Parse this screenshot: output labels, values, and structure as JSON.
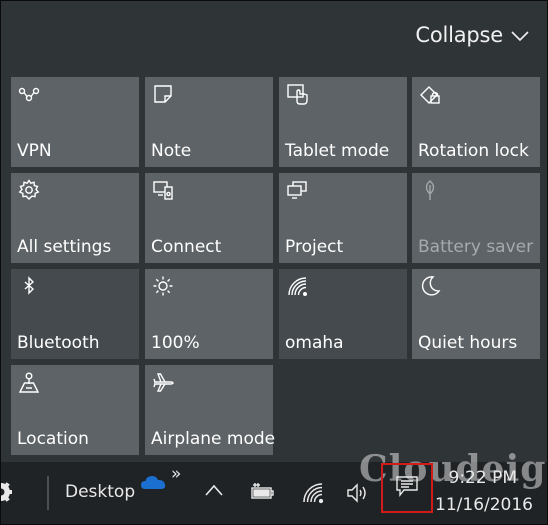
{
  "header": {
    "collapse_label": "Collapse",
    "collapse_icon": "chevron-down-icon"
  },
  "tiles": [
    {
      "label": "VPN",
      "icon": "vpn-icon",
      "state": "off"
    },
    {
      "label": "Note",
      "icon": "note-icon",
      "state": "off"
    },
    {
      "label": "Tablet mode",
      "icon": "tablet-mode-icon",
      "state": "off"
    },
    {
      "label": "Rotation lock",
      "icon": "rotation-lock-icon",
      "state": "off"
    },
    {
      "label": "All settings",
      "icon": "gear-icon",
      "state": "off"
    },
    {
      "label": "Connect",
      "icon": "connect-icon",
      "state": "off"
    },
    {
      "label": "Project",
      "icon": "project-icon",
      "state": "off"
    },
    {
      "label": "Battery saver",
      "icon": "battery-saver-icon",
      "state": "disabled"
    },
    {
      "label": "Bluetooth",
      "icon": "bluetooth-icon",
      "state": "off"
    },
    {
      "label": "100%",
      "icon": "brightness-icon",
      "state": "off"
    },
    {
      "label": "omaha",
      "icon": "wifi-icon",
      "state": "off"
    },
    {
      "label": "Quiet hours",
      "icon": "moon-icon",
      "state": "off"
    },
    {
      "label": "Location",
      "icon": "location-icon",
      "state": "off"
    },
    {
      "label": "Airplane mode",
      "icon": "airplane-icon",
      "state": "off"
    }
  ],
  "taskbar": {
    "desktop_label": "Desktop",
    "overflow_glyph": "»",
    "time": "9:22 PM",
    "date": "11/16/2016"
  },
  "watermark": "Cloudeight",
  "colors": {
    "panel_bg": "#2f3437",
    "tile_bg": "#5d6366",
    "tile_dark_bg": "#444a4e",
    "taskbar_bg": "#1f2326",
    "highlight": "#d21b1b",
    "onedrive": "#1b6fd1"
  }
}
